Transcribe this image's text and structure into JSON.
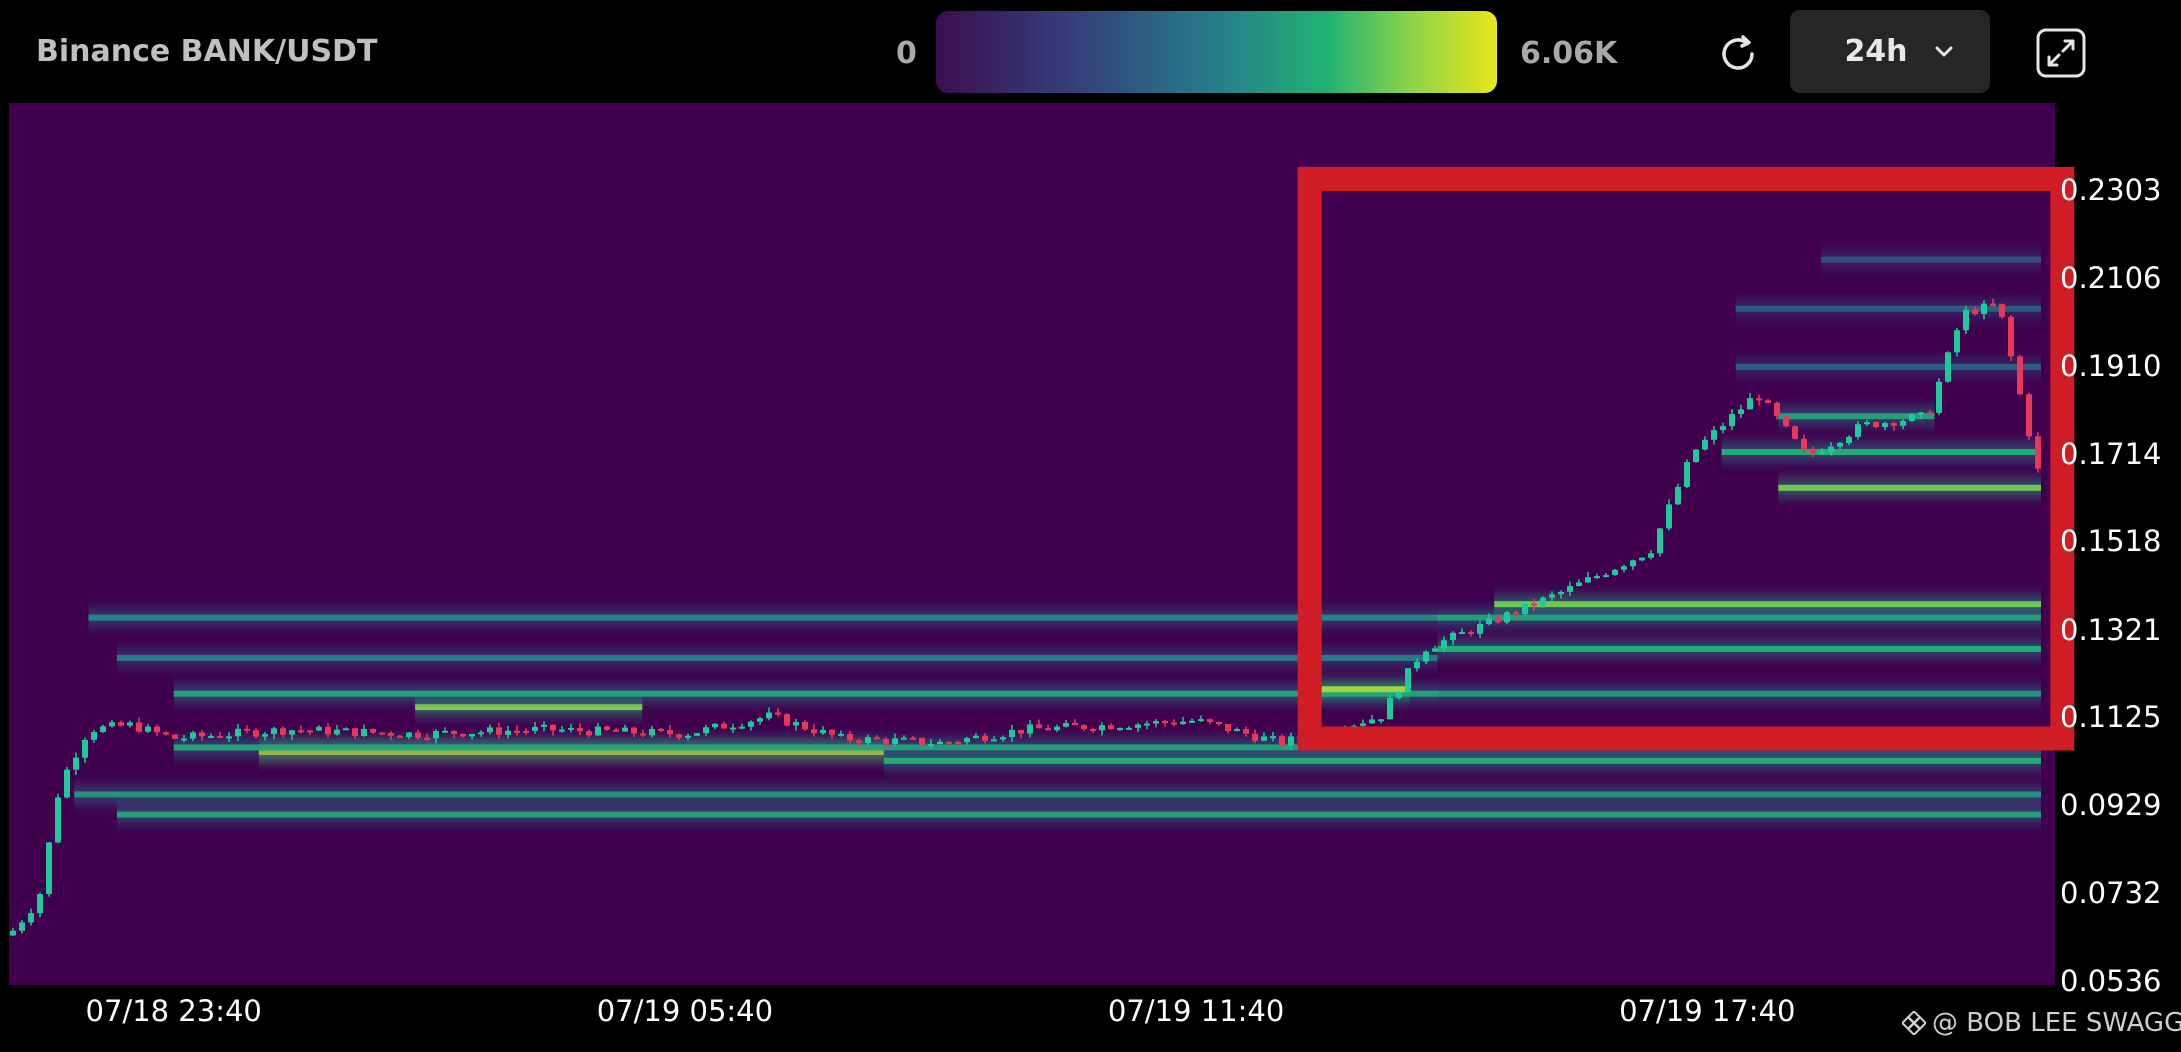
{
  "header": {
    "title": "Binance BANK/USDT"
  },
  "legend": {
    "min_label": "0",
    "max_label": "6.06K",
    "gradient_colors": [
      "#3b0f52",
      "#34407a",
      "#267d8a",
      "#22b274",
      "#8fd547",
      "#e9e51b"
    ]
  },
  "toolbar": {
    "refresh_icon": "refresh-icon",
    "range_value": "24h",
    "range_icon": "chevron-down-icon",
    "expand_icon": "expand-icon"
  },
  "watermark": {
    "icon": "binance-logo-icon",
    "text": "@ BOB LEE SWAGGER"
  },
  "colors": {
    "background": "#40004e",
    "up": "#1ec99b",
    "down": "#e8385a",
    "highlight_box": "#d01c24"
  },
  "chart_data": {
    "type": "heatmap",
    "subtype": "liquidation heatmap with candlesticks",
    "x_tick_labels": [
      "07/18 23:40",
      "07/19 05:40",
      "07/19 11:40",
      "07/19 17:40"
    ],
    "y_tick_labels": [
      "0.2303",
      "0.2106",
      "0.1910",
      "0.1714",
      "0.1518",
      "0.1321",
      "0.1125",
      "0.0929",
      "0.0732",
      "0.0536"
    ],
    "ylim": [
      0.0536,
      0.2303
    ],
    "value_range": [
      0,
      6060
    ],
    "time_start": "07/18 21:44",
    "time_end": "07/19 21:35",
    "price_series": [
      {
        "t": "07/18 21:44",
        "p": 0.064
      },
      {
        "t": "07/18 22:05",
        "p": 0.072
      },
      {
        "t": "07/18 22:20",
        "p": 0.098
      },
      {
        "t": "07/18 22:40",
        "p": 0.11
      },
      {
        "t": "07/18 23:10",
        "p": 0.111
      },
      {
        "t": "07/18 23:40",
        "p": 0.108
      },
      {
        "t": "07/19 01:00",
        "p": 0.11
      },
      {
        "t": "07/19 02:30",
        "p": 0.109
      },
      {
        "t": "07/19 04:00",
        "p": 0.11
      },
      {
        "t": "07/19 05:40",
        "p": 0.109
      },
      {
        "t": "07/19 06:40",
        "p": 0.113
      },
      {
        "t": "07/19 07:30",
        "p": 0.108
      },
      {
        "t": "07/19 08:40",
        "p": 0.107
      },
      {
        "t": "07/19 09:40",
        "p": 0.11
      },
      {
        "t": "07/19 11:40",
        "p": 0.112
      },
      {
        "t": "07/19 12:40",
        "p": 0.107
      },
      {
        "t": "07/19 13:50",
        "p": 0.113
      },
      {
        "t": "07/19 14:20",
        "p": 0.128
      },
      {
        "t": "07/19 15:00",
        "p": 0.133
      },
      {
        "t": "07/19 16:00",
        "p": 0.141
      },
      {
        "t": "07/19 17:00",
        "p": 0.15
      },
      {
        "t": "07/19 17:30",
        "p": 0.172
      },
      {
        "t": "07/19 18:15",
        "p": 0.185
      },
      {
        "t": "07/19 18:50",
        "p": 0.171
      },
      {
        "t": "07/19 19:30",
        "p": 0.178
      },
      {
        "t": "07/19 20:15",
        "p": 0.18
      },
      {
        "t": "07/19 20:40",
        "p": 0.203
      },
      {
        "t": "07/19 21:05",
        "p": 0.205
      },
      {
        "t": "07/19 21:20",
        "p": 0.185
      },
      {
        "t": "07/19 21:35",
        "p": 0.165
      }
    ],
    "liquidation_levels": [
      {
        "price": 0.105,
        "t_from": "07/19 00:40",
        "t_to": "07/19 08:00",
        "intensity": 1.0
      },
      {
        "price": 0.106,
        "t_from": "07/18 23:40",
        "t_to": "07/19 21:35",
        "intensity": 0.55
      },
      {
        "price": 0.103,
        "t_from": "07/19 08:00",
        "t_to": "07/19 21:35",
        "intensity": 0.6
      },
      {
        "price": 0.0955,
        "t_from": "07/18 22:30",
        "t_to": "07/19 21:35",
        "intensity": 0.5
      },
      {
        "price": 0.091,
        "t_from": "07/18 23:00",
        "t_to": "07/19 21:35",
        "intensity": 0.55
      },
      {
        "price": 0.115,
        "t_from": "07/19 02:30",
        "t_to": "07/19 05:10",
        "intensity": 0.8
      },
      {
        "price": 0.118,
        "t_from": "07/18 23:40",
        "t_to": "07/19 14:30",
        "intensity": 0.55
      },
      {
        "price": 0.119,
        "t_from": "07/19 13:00",
        "t_to": "07/19 14:10",
        "intensity": 0.85
      },
      {
        "price": 0.126,
        "t_from": "07/18 23:00",
        "t_to": "07/19 14:30",
        "intensity": 0.4
      },
      {
        "price": 0.135,
        "t_from": "07/18 22:40",
        "t_to": "07/19 14:30",
        "intensity": 0.45
      },
      {
        "price": 0.135,
        "t_from": "07/19 14:30",
        "t_to": "07/19 21:35",
        "intensity": 0.55
      },
      {
        "price": 0.138,
        "t_from": "07/19 15:10",
        "t_to": "07/19 21:35",
        "intensity": 0.75
      },
      {
        "price": 0.128,
        "t_from": "07/19 14:30",
        "t_to": "07/19 21:35",
        "intensity": 0.6
      },
      {
        "price": 0.118,
        "t_from": "07/19 14:30",
        "t_to": "07/19 21:35",
        "intensity": 0.5
      },
      {
        "price": 0.164,
        "t_from": "07/19 18:30",
        "t_to": "07/19 21:35",
        "intensity": 0.75
      },
      {
        "price": 0.172,
        "t_from": "07/19 17:50",
        "t_to": "07/19 21:35",
        "intensity": 0.6
      },
      {
        "price": 0.18,
        "t_from": "07/19 18:30",
        "t_to": "07/19 20:20",
        "intensity": 0.55
      },
      {
        "price": 0.191,
        "t_from": "07/19 18:00",
        "t_to": "07/19 21:35",
        "intensity": 0.3
      },
      {
        "price": 0.204,
        "t_from": "07/19 18:00",
        "t_to": "07/19 21:35",
        "intensity": 0.3
      },
      {
        "price": 0.215,
        "t_from": "07/19 19:00",
        "t_to": "07/19 21:35",
        "intensity": 0.25
      }
    ],
    "annotation": {
      "type": "highlight-rectangle",
      "color": "#d01c24",
      "t_from": "07/19 13:00",
      "t_to": "07/19 21:50",
      "price_from": 0.108,
      "price_to": 0.233
    }
  }
}
